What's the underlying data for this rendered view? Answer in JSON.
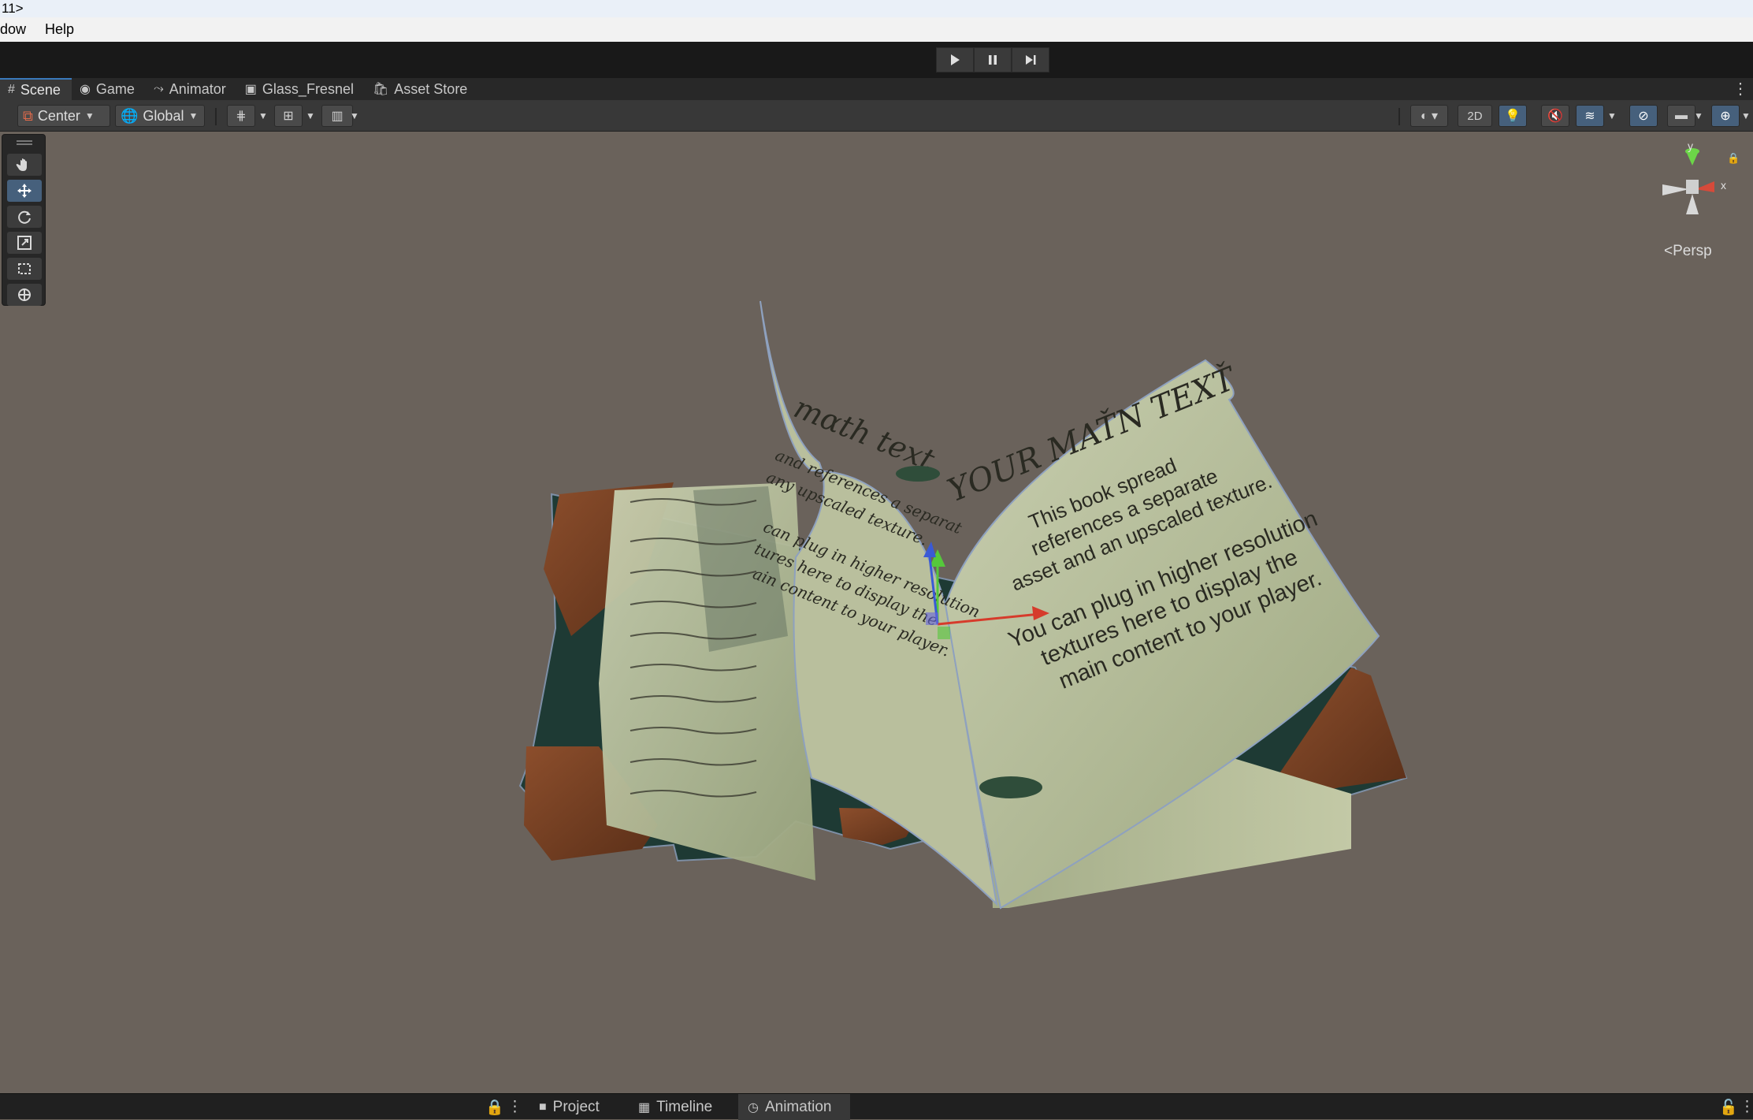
{
  "window": {
    "title": "11>"
  },
  "menu": {
    "items": [
      "dow",
      "Help"
    ]
  },
  "playbar": {
    "play_icon": "play-icon",
    "pause_icon": "pause-icon",
    "step_icon": "step-icon"
  },
  "tabs": [
    {
      "label": "Scene",
      "icon": "grid-icon",
      "active": true
    },
    {
      "label": "Game",
      "icon": "gamepad-icon",
      "active": false
    },
    {
      "label": "Animator",
      "icon": "animator-icon",
      "active": false
    },
    {
      "label": "Glass_Fresnel",
      "icon": "shader-icon",
      "active": false
    },
    {
      "label": "Asset Store",
      "icon": "bag-icon",
      "active": false
    }
  ],
  "scene_toolbar": {
    "pivot_label": "Center",
    "space_label": "Global",
    "twod_label": "2D"
  },
  "gizmo": {
    "y_label": "y",
    "x_label": "x",
    "projection": "Persp",
    "persp_arrow": "<"
  },
  "book": {
    "left_title": "mαth text",
    "right_title": "YOUR MAŤN TEXŤ",
    "right_line1": "This book spread",
    "right_line2": "references a separate",
    "right_line3": "asset and an upscaled texture.",
    "right_line4": "You can plug in higher resolution",
    "right_line5": "textures here to display the",
    "right_line6": "main content to your player.",
    "flip_line1": "and references a separat",
    "flip_line2": "any upscaled texture.",
    "flip_line3": "can plug in higher resolution",
    "flip_line4": "tures here to display the",
    "flip_line5": "ain content to your player."
  },
  "bottom_tabs": [
    {
      "label": "Project",
      "icon": "folder-icon",
      "active": false
    },
    {
      "label": "Timeline",
      "icon": "timeline-icon",
      "active": false
    },
    {
      "label": "Animation",
      "icon": "clock-icon",
      "active": true
    }
  ],
  "colors": {
    "accent": "#3a79bb",
    "viewport_bg": "#6a625b",
    "active_tool": "#46607c"
  }
}
